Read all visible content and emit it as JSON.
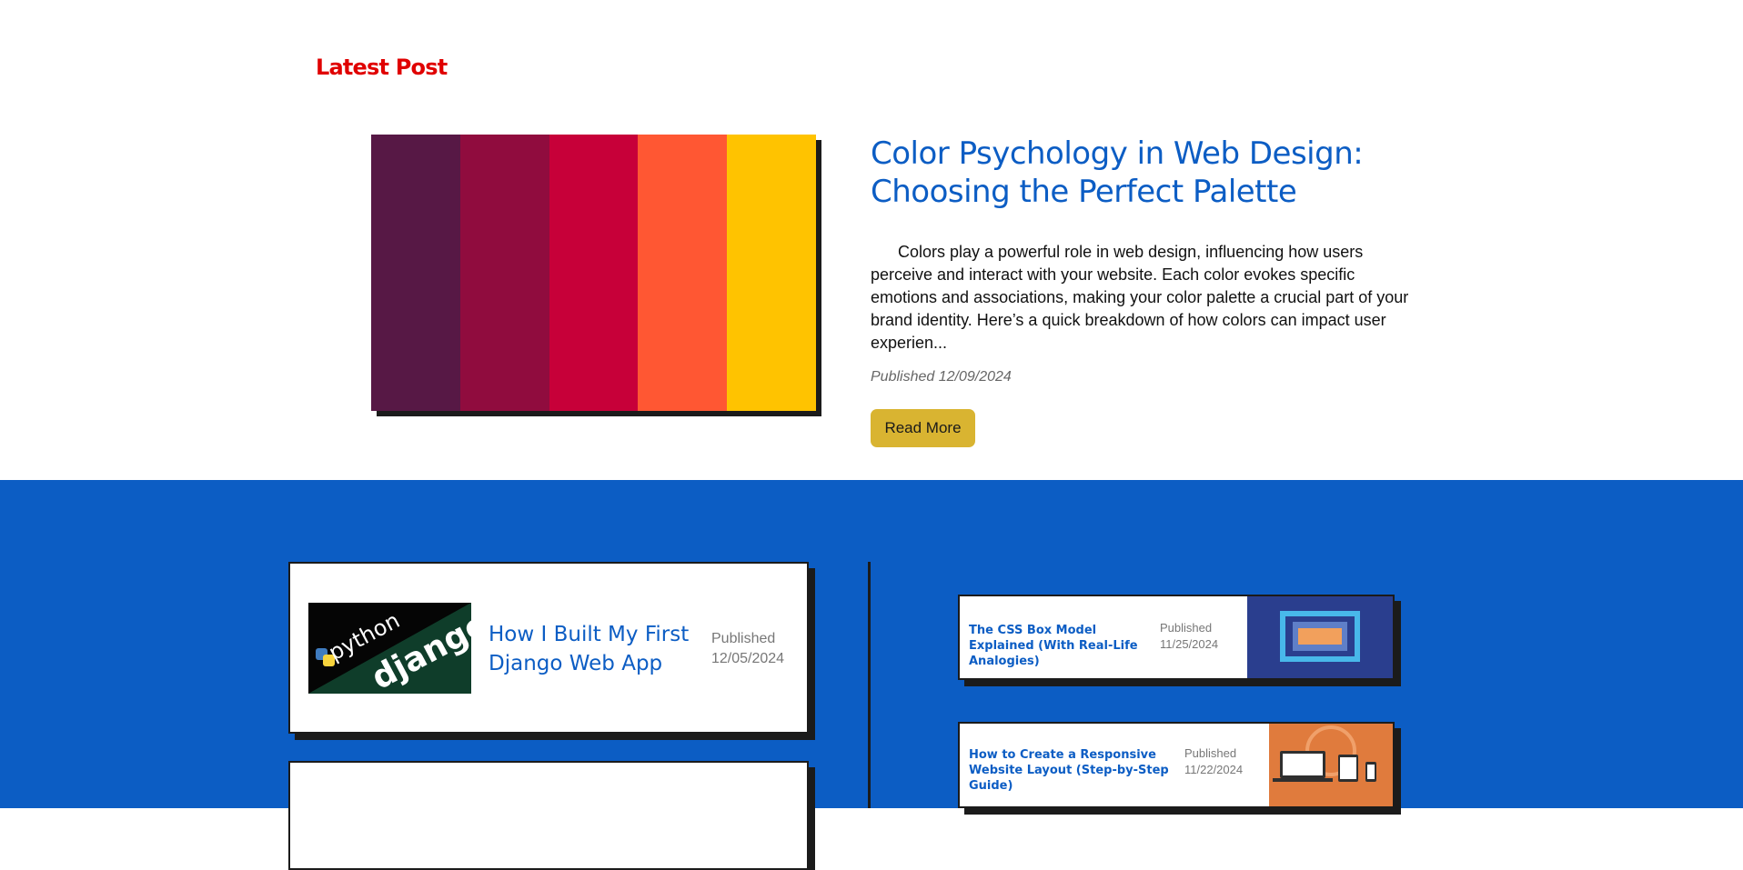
{
  "latest": {
    "heading": "Latest Post",
    "title": "Color Psychology in Web Design: Choosing the Perfect Palette",
    "excerpt": "Colors play a powerful role in web design, influencing how users perceive and interact with your website. Each color evokes specific emotions and associations, making your color palette a crucial part of your brand identity. Here’s a quick breakdown of how colors can impact user experien...",
    "date": "Published 12/09/2024",
    "read_more": "Read More",
    "palette": [
      "#571845",
      "#900c3e",
      "#c70039",
      "#ff5733",
      "#ffc300"
    ]
  },
  "posts": [
    {
      "title": "How I Built My First Django Web App",
      "published_label": "Published",
      "date": "12/05/2024",
      "thumb_text_1": "python",
      "thumb_text_2": "django"
    }
  ],
  "side_posts": [
    {
      "title": "The CSS Box Model Explained (With Real-Life Analogies)",
      "published_label": "Published",
      "date": "11/25/2024"
    },
    {
      "title": "How to Create a Responsive Website Layout (Step-by-Step Guide)",
      "published_label": "Published",
      "date": "11/22/2024"
    }
  ],
  "colors": {
    "accent_blue": "#0c5dc4",
    "heading_red": "#e00000",
    "button_gold": "#d9b431"
  }
}
